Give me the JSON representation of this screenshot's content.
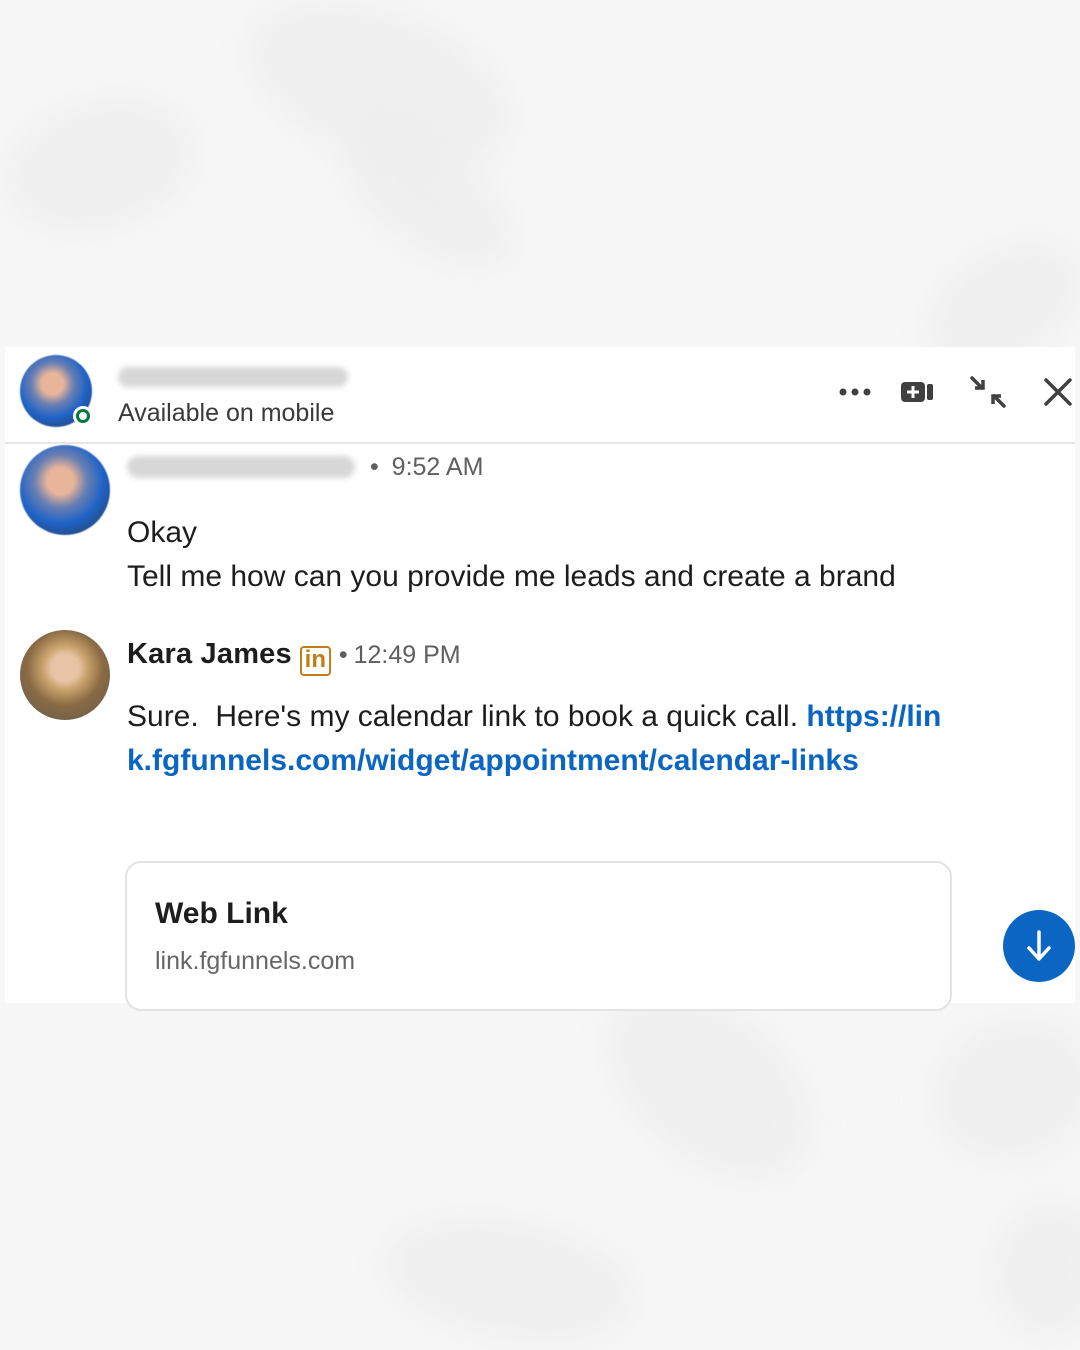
{
  "header": {
    "status": "Available on mobile",
    "actions": [
      {
        "name": "more-options",
        "icon": "ellipsis-icon"
      },
      {
        "name": "video-call",
        "icon": "video-camera-icon"
      },
      {
        "name": "minimize",
        "icon": "collapse-arrows-icon"
      },
      {
        "name": "close",
        "icon": "close-icon"
      }
    ]
  },
  "messages": [
    {
      "sender": "",
      "time": "9:52 AM",
      "lines": [
        "Okay",
        "Tell me how can you provide me leads and create a brand"
      ]
    },
    {
      "sender": "Kara James",
      "badge": "in",
      "time": "12:49 PM",
      "text": "Sure.  Here's my calendar link to book a quick call.",
      "link": "https://link.fgfunnels.com/widget/appointment/calendar-links"
    }
  ],
  "link_card": {
    "title": "Web Link",
    "domain": "link.fgfunnels.com"
  },
  "colors": {
    "accent": "#0a66c2",
    "online": "#057642",
    "premium_badge": "#c37d16"
  }
}
